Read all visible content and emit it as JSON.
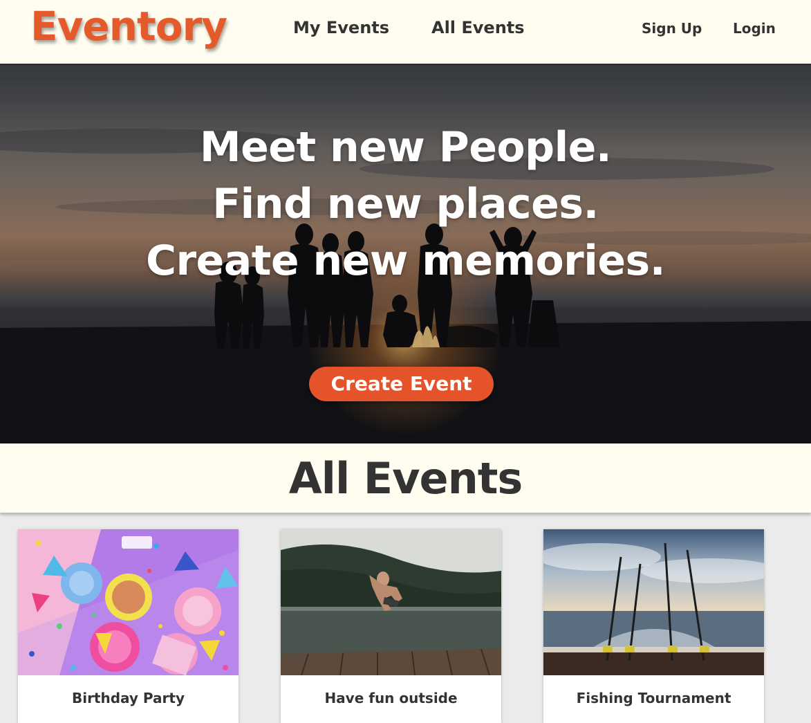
{
  "nav": {
    "logo": "Eventory",
    "my_events": "My Events",
    "all_events": "All Events",
    "sign_up": "Sign Up",
    "login": "Login"
  },
  "hero": {
    "lines": [
      "Meet new People.",
      "Find new places.",
      "Create new memories."
    ],
    "cta_label": "Create Event"
  },
  "section": {
    "title": "All Events"
  },
  "events": [
    {
      "title": "Birthday Party"
    },
    {
      "title": "Have fun outside"
    },
    {
      "title": "Fishing Tournament"
    }
  ],
  "colors": {
    "accent": "#e5532a",
    "nav_background": "#fffdf0",
    "text_dark": "#333333"
  }
}
